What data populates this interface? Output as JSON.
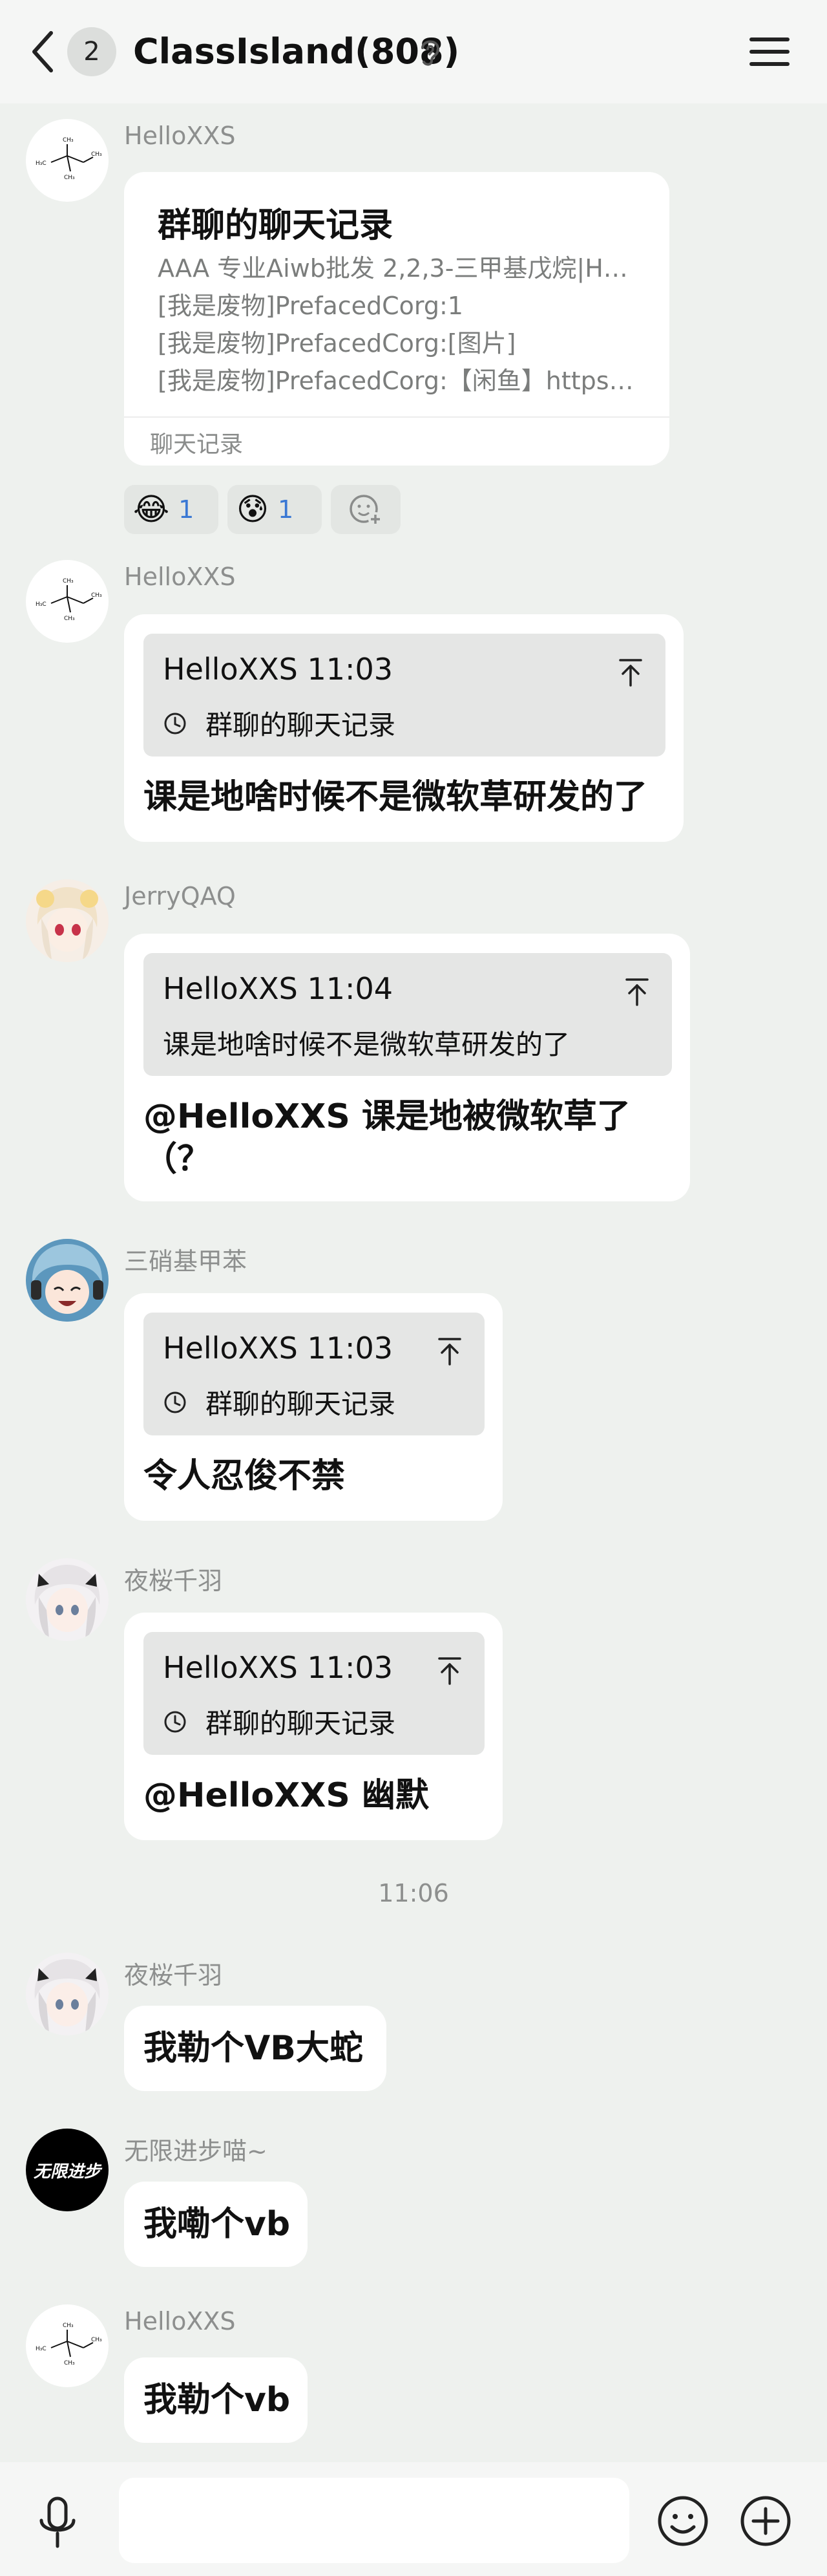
{
  "header": {
    "unread_count": "2",
    "title": "ClassIsland(808)"
  },
  "messages": {
    "m1": {
      "sender": "HelloXXS",
      "card_title": "群聊的聊天记录",
      "lines": [
        "AAA 专业Aiwb批发 2,2,3-三甲基戊烷|H…",
        "[我是废物]PrefacedCorg:1",
        "[我是废物]PrefacedCorg:[图片]",
        "[我是废物]PrefacedCorg:【闲鱼】https…"
      ],
      "footer": "聊天记录",
      "reactions": [
        {
          "emoji": "😂",
          "count": "1"
        },
        {
          "emoji": "😰",
          "count": "1"
        }
      ]
    },
    "m2": {
      "sender": "HelloXXS",
      "quote_head": "HelloXXS 11:03",
      "quote_body": "群聊的聊天记录",
      "text": "课是地啥时候不是微软草研发的了"
    },
    "m3": {
      "sender": "JerryQAQ",
      "quote_head": "HelloXXS 11:04",
      "quote_body": "课是地啥时候不是微软草研发的了",
      "text_line1": "@HelloXXS 课是地被微软草了",
      "text_line2": "（？"
    },
    "m4": {
      "sender": "三硝基甲苯",
      "quote_head": "HelloXXS 11:03",
      "quote_body": "群聊的聊天记录",
      "text": "令人忍俊不禁"
    },
    "m5": {
      "sender": "夜桜千羽",
      "quote_head": "HelloXXS 11:03",
      "quote_body": "群聊的聊天记录",
      "text": "@HelloXXS 幽默"
    },
    "time_separator": "11:06",
    "m6": {
      "sender": "夜桜千羽",
      "text": "我勒个VB大蛇"
    },
    "m7": {
      "sender": "无限进步喵~",
      "avatar_text": "无限进步",
      "text": "我嘞个vb"
    },
    "m8": {
      "sender": "HelloXXS",
      "text": "我勒个vb"
    }
  },
  "input": {
    "placeholder": ""
  },
  "colors": {
    "background": "#eef1ee",
    "bubble": "#ffffff",
    "quote": "#e5e6e5",
    "reaction_count": "#3a78d4"
  }
}
